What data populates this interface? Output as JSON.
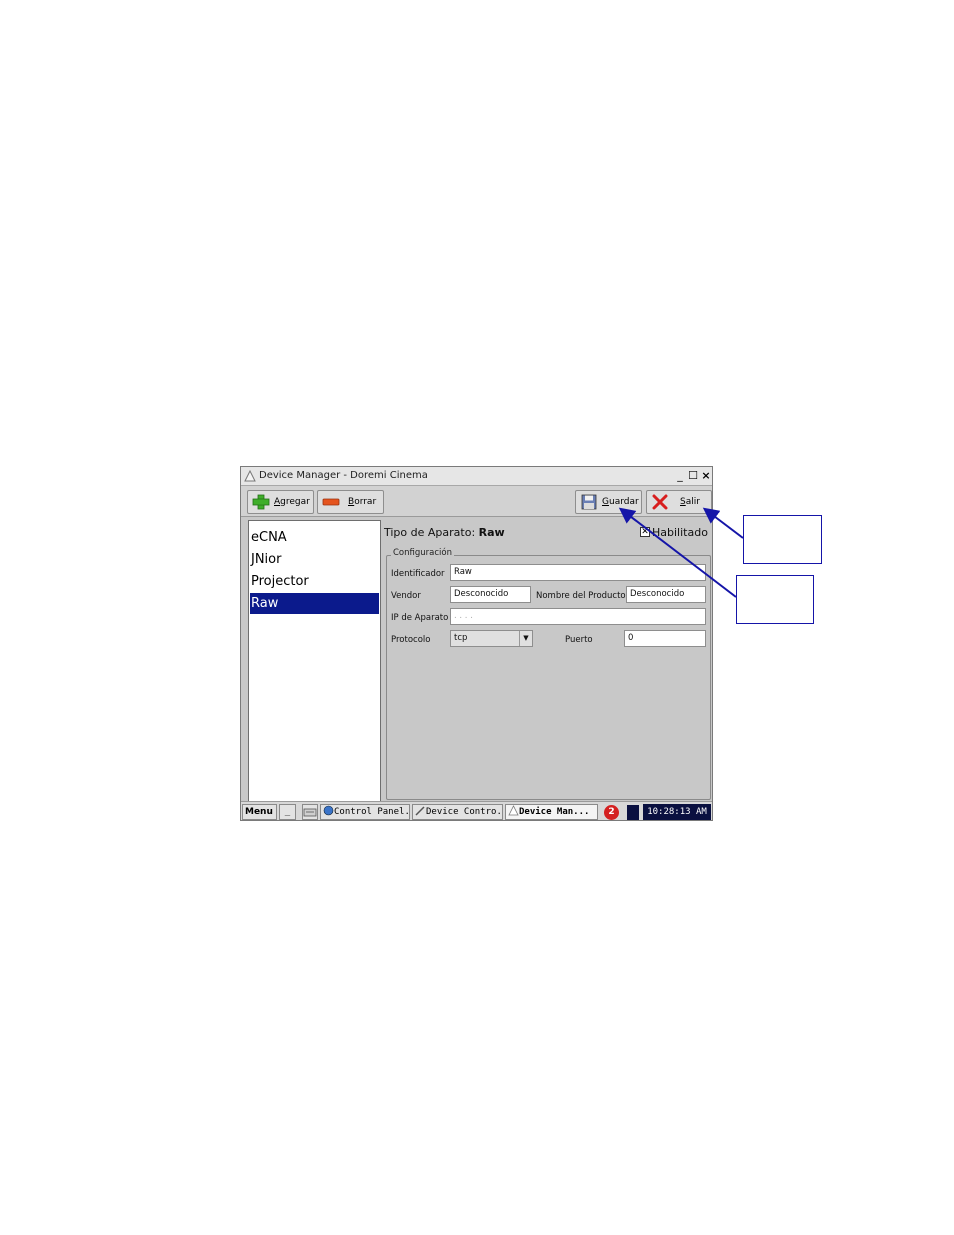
{
  "window": {
    "title": "Device Manager - Doremi Cinema",
    "controls": [
      "_",
      "☐",
      "×"
    ]
  },
  "toolbar": {
    "add_label": "Agregar",
    "delete_label": "Borrar",
    "save_label": "Guardar",
    "exit_label": "Salir"
  },
  "device_list": [
    "eCNA",
    "JNior",
    "Projector",
    "Raw"
  ],
  "device_list_selected": "Raw",
  "detail": {
    "type_prefix": "Tipo de Aparato:",
    "type_value": "Raw",
    "enabled_label": "Habilitado",
    "enabled_checked": true,
    "group_title": "Configuración",
    "identifier_label": "Identificador",
    "identifier_value": "Raw",
    "vendor_label": "Vendor",
    "vendor_value": "Desconocido",
    "product_label": "Nombre del Producto",
    "product_value": "Desconocido",
    "ip_label": "IP de Aparato",
    "ip_value": ". . . .",
    "protocol_label": "Protocolo",
    "protocol_value": "tcp",
    "port_label": "Puerto",
    "port_value": "0"
  },
  "taskbar": {
    "menu_label": "Menu",
    "minimize_label": "_",
    "tasks": [
      "Control Panel...",
      "Device Contro...",
      "Device Man..."
    ],
    "notification_count": "2",
    "clock": "10:28:13 AM"
  },
  "colors": {
    "selection": "#0b1a8c",
    "arrow": "#1515a8",
    "window_bg": "#c8c8c8"
  }
}
